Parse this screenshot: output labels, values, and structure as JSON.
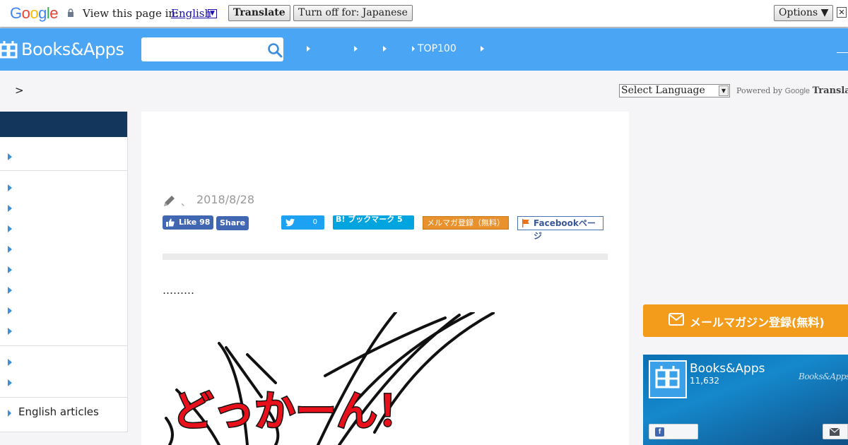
{
  "translate_bar": {
    "label": "View this page in:",
    "language": "English",
    "translate_button": "Translate",
    "turn_off_button": "Turn off for: Japanese",
    "options_button": "Options ▼",
    "close": "✕"
  },
  "header": {
    "logo_text": "Books&Apps",
    "search_placeholder": "",
    "nav_items": [
      "",
      "",
      "",
      "TOP100",
      ""
    ]
  },
  "breadcrumb": ">",
  "translate_widget": {
    "select_label": "Select Language",
    "powered_by": "Powered by",
    "brand": "Google",
    "product": "Translate"
  },
  "sidebar": {
    "last_item": "English articles"
  },
  "article": {
    "author_sep": "、",
    "date": "2018/8/28",
    "fb_like": "Like 98",
    "fb_share": "Share",
    "tweet_count": "0",
    "hatena": "B! ブックマーク 5",
    "mail_magazine": "メルマガ登録（無料）",
    "facebook_page": "Facebookページ",
    "lead_text": "………",
    "comic_text": "どっかーん！"
  },
  "right": {
    "mail_banner": "メールマガジン登録(無料)",
    "fb_widget": {
      "page_name": "Books&Apps",
      "likes": "11,632",
      "watermark": "Books&Apps"
    }
  },
  "colors": {
    "header": "#4aa5f5",
    "sidebar_head": "#13375c",
    "mail_orange": "#f39c1c",
    "facebook": "#4267b2"
  }
}
